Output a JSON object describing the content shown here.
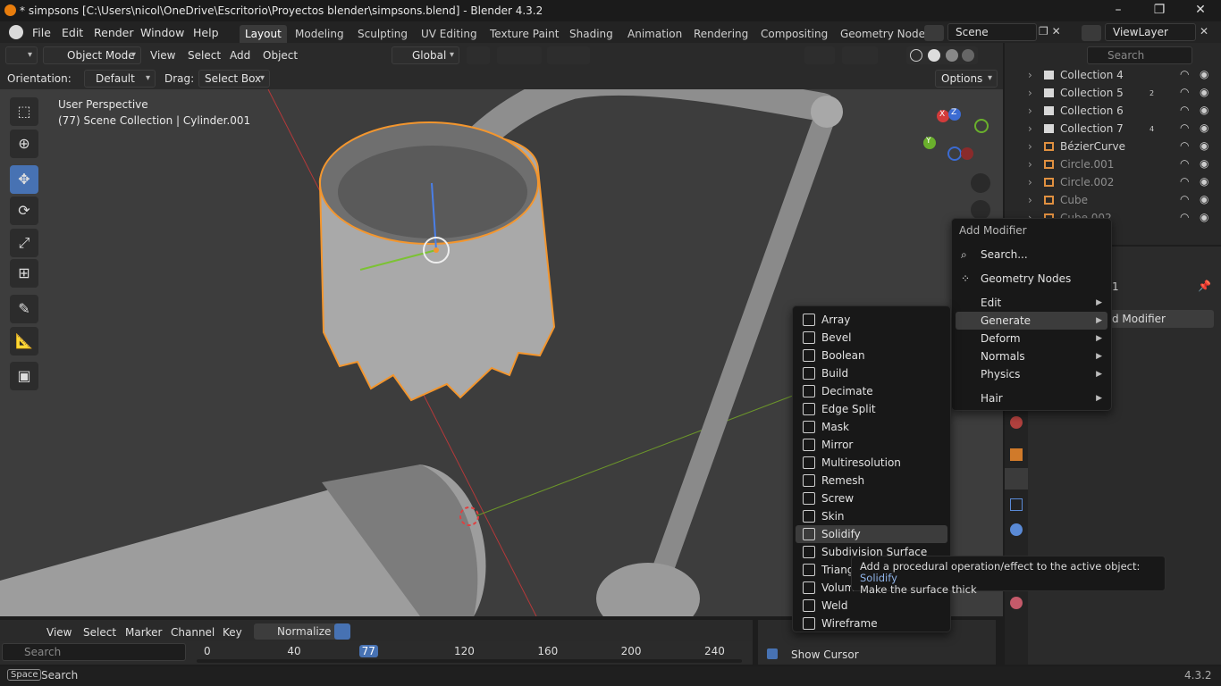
{
  "window": {
    "title": "* simpsons [C:\\Users\\nicol\\OneDrive\\Escritorio\\Proyectos blender\\simpsons.blend] - Blender 4.3.2",
    "controls": [
      "–",
      "❐",
      "✕"
    ]
  },
  "menubar": {
    "items": [
      "File",
      "Edit",
      "Render",
      "Window",
      "Help"
    ],
    "workspaces": [
      "Layout",
      "Modeling",
      "Sculpting",
      "UV Editing",
      "Texture Paint",
      "Shading",
      "Animation",
      "Rendering",
      "Compositing",
      "Geometry Node"
    ],
    "active_workspace": "Layout",
    "scene": "Scene",
    "view_layer": "ViewLayer"
  },
  "viewport_header": {
    "mode": "Object Mode",
    "menus": [
      "View",
      "Select",
      "Add",
      "Object"
    ],
    "transform_orientation": "Global"
  },
  "tool_settings": {
    "orientation_label": "Orientation:",
    "orientation_value": "Default",
    "drag_label": "Drag:",
    "drag_value": "Select Box",
    "options_label": "Options"
  },
  "viewport": {
    "perspective": "User Perspective",
    "collection_info": "(77) Scene Collection | Cylinder.001",
    "gizmo_axes": [
      "X",
      "Y",
      "Z"
    ]
  },
  "outliner": {
    "search_placeholder": "Search",
    "rows": [
      {
        "name": "Collection 4",
        "type": "collection",
        "dim": false
      },
      {
        "name": "Collection 5",
        "type": "collection",
        "dim": false,
        "badge": "2"
      },
      {
        "name": "Collection 6",
        "type": "collection",
        "dim": false
      },
      {
        "name": "Collection 7",
        "type": "collection",
        "dim": false,
        "badge": "4"
      },
      {
        "name": "BézierCurve",
        "type": "curve",
        "dim": false
      },
      {
        "name": "Circle.001",
        "type": "mesh",
        "dim": true
      },
      {
        "name": "Circle.002",
        "type": "mesh",
        "dim": true
      },
      {
        "name": "Cube",
        "type": "mesh",
        "dim": true
      },
      {
        "name": "Cube.002",
        "type": "mesh",
        "dim": true
      }
    ]
  },
  "properties": {
    "object_suffix": "1",
    "add_modifier_label": "d Modifier"
  },
  "add_modifier_menu": {
    "title": "Add Modifier",
    "search": "Search...",
    "geometry_nodes": "Geometry Nodes",
    "categories": [
      "Edit",
      "Generate",
      "Deform",
      "Normals",
      "Physics",
      "Hair"
    ],
    "active_category": "Generate"
  },
  "generate_submenu": {
    "items": [
      "Array",
      "Bevel",
      "Boolean",
      "Build",
      "Decimate",
      "Edge Split",
      "Mask",
      "Mirror",
      "Multiresolution",
      "Remesh",
      "Screw",
      "Skin",
      "Solidify",
      "Subdivision Surface",
      "Triang",
      "Volum",
      "Weld",
      "Wireframe"
    ],
    "highlighted": "Solidify"
  },
  "tooltip": {
    "line1_prefix": "Add a procedural operation/effect to the active object: ",
    "line1_highlight": "Solidify",
    "line2": "Make the surface thick"
  },
  "timeline": {
    "menus": [
      "View",
      "Select",
      "Marker",
      "Channel",
      "Key"
    ],
    "normalize": "Normalize",
    "search_placeholder": "Search",
    "frames": [
      "0",
      "40",
      "77",
      "120",
      "160",
      "200",
      "240"
    ],
    "current_frame": "77",
    "show_cursor": "Show Cursor"
  },
  "statusbar": {
    "key": "Space",
    "action": "Search",
    "version": "4.3.2"
  }
}
